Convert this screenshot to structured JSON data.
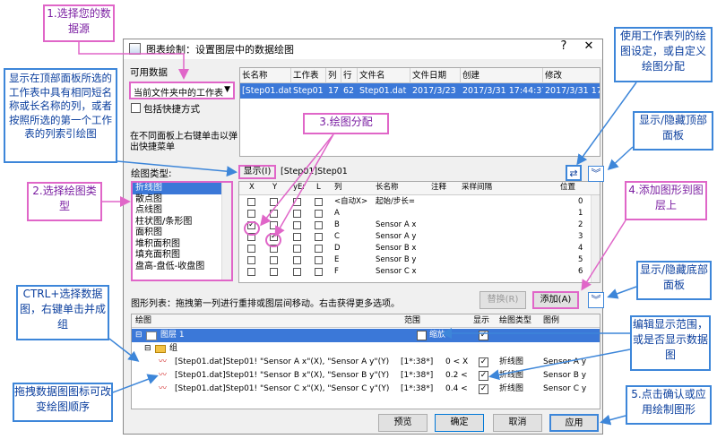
{
  "dialog": {
    "title": "图表绘制：设置图层中的数据绘图",
    "help_label": "?",
    "close_label": "✕"
  },
  "source": {
    "available_data_label": "可用数据",
    "combo_value": "当前文件夹中的工作表",
    "shortcut_label": "包括快捷方式",
    "hint": "在不同面板上右键单击以弹出快捷菜单"
  },
  "sheet_table": {
    "headers": [
      "长名称",
      "工作表",
      "列",
      "行",
      "文件名",
      "文件日期",
      "创建",
      "修改"
    ],
    "rows": [
      [
        "[Step01.dat]",
        "Step01",
        "17",
        "62",
        "Step01.dat",
        "2017/3/23",
        "2017/3/31 17:44:37",
        "2017/3/31 17:44:37"
      ]
    ]
  },
  "plot_type": {
    "label": "绘图类型:",
    "items": [
      "折线图",
      "散点图",
      "点线图",
      "柱状图/条形图",
      "面积图",
      "堆积面积图",
      "填充面积图",
      "盘高-盘低-收盘图"
    ],
    "selected_index": 0
  },
  "display": {
    "button": "显示(I)",
    "path": "[Step01]Step01"
  },
  "column_grid": {
    "headers": [
      "X",
      "Y",
      "yEr",
      "L",
      "列",
      "长名称",
      "注释",
      "采样间隔",
      "位置"
    ],
    "rows": [
      {
        "col": "<自动X>",
        "name": "起始/步长=",
        "pos": "0",
        "x": false,
        "y": false
      },
      {
        "col": "A",
        "name": "",
        "pos": "1",
        "x": false,
        "y": false
      },
      {
        "col": "B",
        "name": "Sensor A x",
        "pos": "2",
        "x": true,
        "y": false
      },
      {
        "col": "C",
        "name": "Sensor A y",
        "pos": "3",
        "x": false,
        "y": true
      },
      {
        "col": "D",
        "name": "Sensor B x",
        "pos": "4",
        "x": false,
        "y": false
      },
      {
        "col": "E",
        "name": "Sensor B y",
        "pos": "5",
        "x": false,
        "y": false
      },
      {
        "col": "F",
        "name": "Sensor C x",
        "pos": "6",
        "x": false,
        "y": false
      }
    ]
  },
  "plot_list": {
    "hint": "图形列表：拖拽第一列进行重排或图层间移动。右击获得更多选项。",
    "replace_button": "替换(R)",
    "add_button": "添加(A)",
    "tree_headers": [
      "绘图",
      "范围",
      "显示",
      "绘图类型",
      "图例"
    ],
    "layer": {
      "label": "图层 1",
      "range": "缩放"
    },
    "group_label": "组",
    "plots": [
      {
        "text": "[Step01.dat]Step01! \"Sensor A x\"(X), \"Sensor A y\"(Y)",
        "range": "[1*:38*]",
        "cond": "0 < X",
        "type": "折线图",
        "legend": "Sensor A y"
      },
      {
        "text": "[Step01.dat]Step01! \"Sensor B x\"(X), \"Sensor B y\"(Y)",
        "range": "[1*:38*]",
        "cond": "0.2 <",
        "type": "折线图",
        "legend": "Sensor B y"
      },
      {
        "text": "[Step01.dat]Step01! \"Sensor C x\"(X), \"Sensor C y\"(Y)",
        "range": "[1*:38*]",
        "cond": "0.4 <",
        "type": "折线图",
        "legend": "Sensor C y"
      }
    ]
  },
  "buttons": {
    "preview": "预览",
    "ok": "确定",
    "cancel": "取消",
    "apply": "应用"
  },
  "callouts": {
    "c1": "1.选择您的数据源",
    "c_top_left": "显示在顶部面板所选的工作表中具有相同短名称或长名称的列，或者按照所选的第一个工作表的列索引绘图",
    "c2": "2.选择绘图类型",
    "c3": "3.绘图分配",
    "c_ctrl": "CTRL+选择数据图，右键单击并成组",
    "c_drag": "拖拽数据图图标可改变绘图顺序",
    "c_use_sheet": "使用工作表列的绘图设定，或自定义绘图分配",
    "c_top_panel": "显示/隐藏顶部面板",
    "c4": "4.添加图形到图层上",
    "c_bottom_panel": "显示/隐藏底部面板",
    "c_edit_range": "编辑显示范围，或是否显示数据图",
    "c5": "5.点击确认或应用绘制图形"
  },
  "colors": {
    "pink": "#e066c8",
    "blue": "#3d86d9",
    "select": "#3b78d8"
  }
}
